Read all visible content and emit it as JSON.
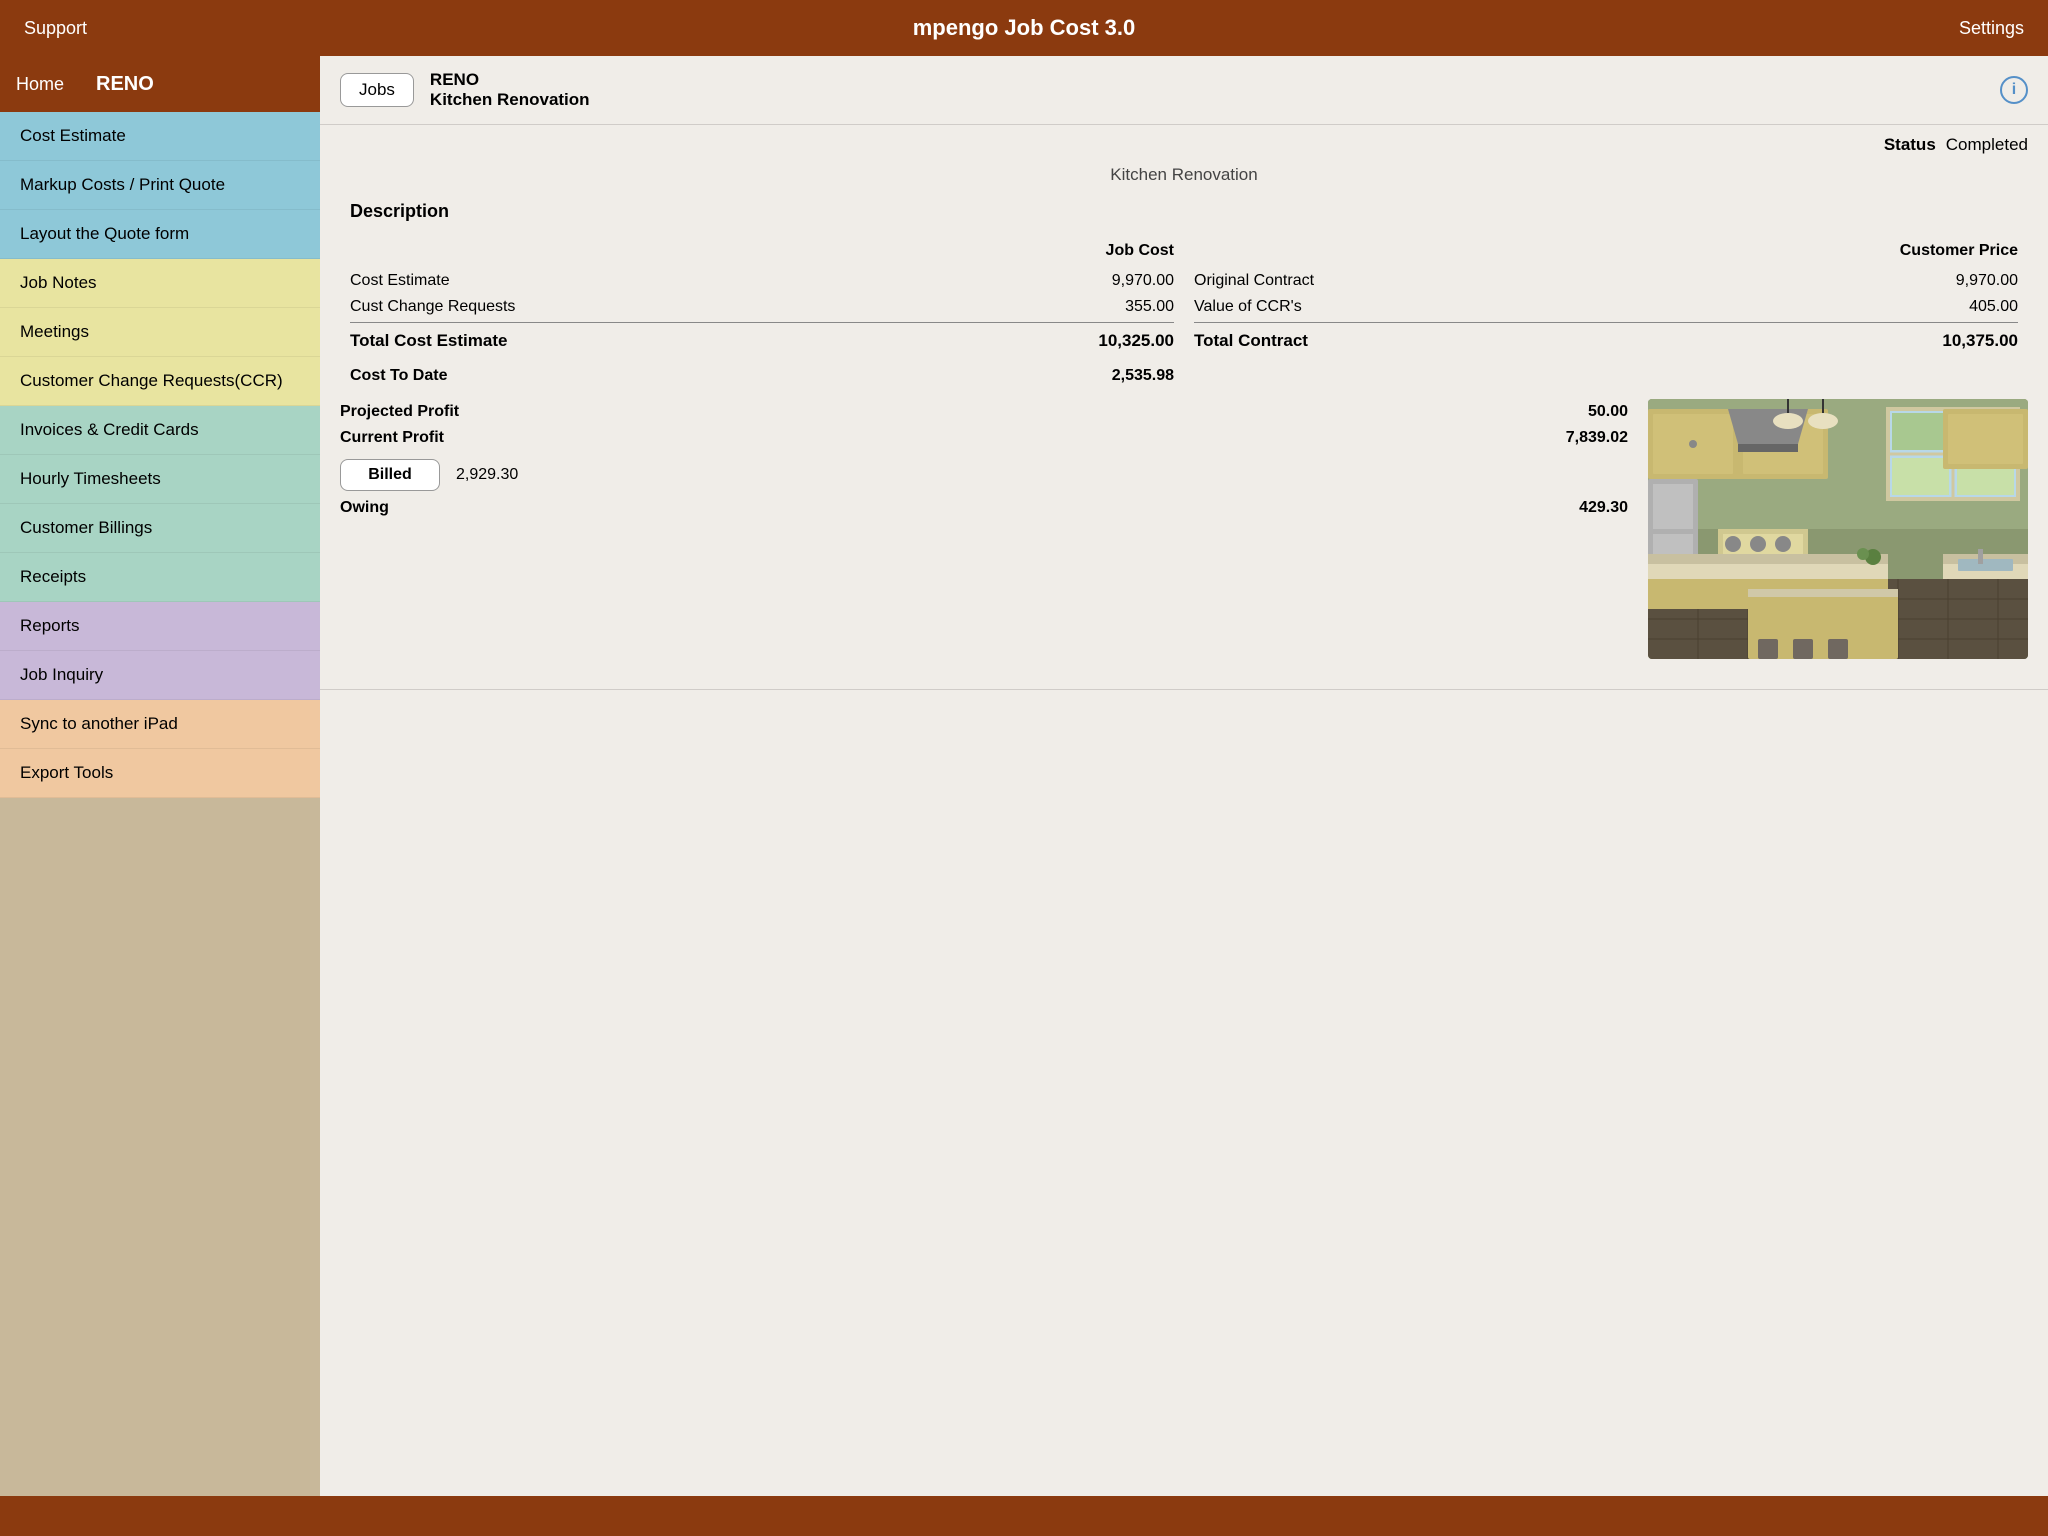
{
  "topBar": {
    "support": "Support",
    "title": "mpengo Job Cost 3.0",
    "settings": "Settings"
  },
  "sidebar": {
    "home": "Home",
    "reno": "RENO",
    "sections": [
      {
        "colorClass": "section-blue",
        "items": [
          "Cost Estimate",
          "Markup Costs / Print Quote",
          "Layout the Quote form"
        ]
      },
      {
        "colorClass": "section-yellow",
        "items": [
          "Job Notes",
          "Meetings",
          "Customer Change Requests(CCR)"
        ]
      },
      {
        "colorClass": "section-teal",
        "items": [
          "Invoices & Credit Cards",
          "Hourly Timesheets",
          "Customer Billings",
          "Receipts"
        ]
      },
      {
        "colorClass": "section-purple",
        "items": [
          "Reports",
          "Job Inquiry"
        ]
      },
      {
        "colorClass": "section-peach",
        "items": [
          "Sync to another iPad",
          "Export Tools"
        ]
      }
    ]
  },
  "content": {
    "jobsButton": "Jobs",
    "jobReno": "RENO",
    "jobName": "Kitchen Renovation",
    "statusLabel": "Status",
    "statusValue": "Completed",
    "centerTitle": "Kitchen Renovation",
    "descriptionLabel": "Description",
    "jobCostHeader": "Job Cost",
    "customerPriceHeader": "Customer Price",
    "leftRows": [
      {
        "label": "Cost Estimate",
        "value": "9,970.00",
        "bold": false
      },
      {
        "label": "Cust Change Requests",
        "value": "355.00",
        "bold": false
      }
    ],
    "leftTotal": {
      "label": "Total Cost Estimate",
      "value": "10,325.00"
    },
    "costToDate": {
      "label": "Cost To Date",
      "value": "2,535.98"
    },
    "rightRows": [
      {
        "label": "Original Contract",
        "value": "9,970.00"
      },
      {
        "label": "Value of CCR's",
        "value": "405.00"
      }
    ],
    "rightTotal": {
      "label": "Total Contract",
      "value": "10,375.00"
    },
    "projectedProfit": {
      "label": "Projected Profit",
      "value": "50.00"
    },
    "currentProfit": {
      "label": "Current Profit",
      "value": "7,839.02"
    },
    "billedButton": "Billed",
    "billedValue": "2,929.30",
    "owing": {
      "label": "Owing",
      "value": "429.30"
    }
  }
}
